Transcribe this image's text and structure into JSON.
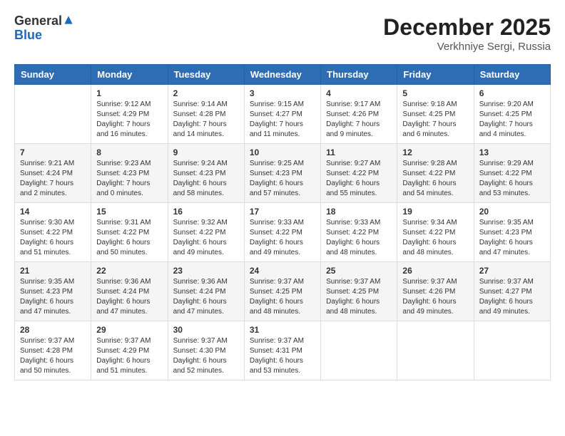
{
  "header": {
    "logo_general": "General",
    "logo_blue": "Blue",
    "month_title": "December 2025",
    "location": "Verkhniye Sergi, Russia"
  },
  "weekdays": [
    "Sunday",
    "Monday",
    "Tuesday",
    "Wednesday",
    "Thursday",
    "Friday",
    "Saturday"
  ],
  "weeks": [
    [
      {
        "day": "",
        "info": ""
      },
      {
        "day": "1",
        "info": "Sunrise: 9:12 AM\nSunset: 4:29 PM\nDaylight: 7 hours\nand 16 minutes."
      },
      {
        "day": "2",
        "info": "Sunrise: 9:14 AM\nSunset: 4:28 PM\nDaylight: 7 hours\nand 14 minutes."
      },
      {
        "day": "3",
        "info": "Sunrise: 9:15 AM\nSunset: 4:27 PM\nDaylight: 7 hours\nand 11 minutes."
      },
      {
        "day": "4",
        "info": "Sunrise: 9:17 AM\nSunset: 4:26 PM\nDaylight: 7 hours\nand 9 minutes."
      },
      {
        "day": "5",
        "info": "Sunrise: 9:18 AM\nSunset: 4:25 PM\nDaylight: 7 hours\nand 6 minutes."
      },
      {
        "day": "6",
        "info": "Sunrise: 9:20 AM\nSunset: 4:25 PM\nDaylight: 7 hours\nand 4 minutes."
      }
    ],
    [
      {
        "day": "7",
        "info": "Sunrise: 9:21 AM\nSunset: 4:24 PM\nDaylight: 7 hours\nand 2 minutes."
      },
      {
        "day": "8",
        "info": "Sunrise: 9:23 AM\nSunset: 4:23 PM\nDaylight: 7 hours\nand 0 minutes."
      },
      {
        "day": "9",
        "info": "Sunrise: 9:24 AM\nSunset: 4:23 PM\nDaylight: 6 hours\nand 58 minutes."
      },
      {
        "day": "10",
        "info": "Sunrise: 9:25 AM\nSunset: 4:23 PM\nDaylight: 6 hours\nand 57 minutes."
      },
      {
        "day": "11",
        "info": "Sunrise: 9:27 AM\nSunset: 4:22 PM\nDaylight: 6 hours\nand 55 minutes."
      },
      {
        "day": "12",
        "info": "Sunrise: 9:28 AM\nSunset: 4:22 PM\nDaylight: 6 hours\nand 54 minutes."
      },
      {
        "day": "13",
        "info": "Sunrise: 9:29 AM\nSunset: 4:22 PM\nDaylight: 6 hours\nand 53 minutes."
      }
    ],
    [
      {
        "day": "14",
        "info": "Sunrise: 9:30 AM\nSunset: 4:22 PM\nDaylight: 6 hours\nand 51 minutes."
      },
      {
        "day": "15",
        "info": "Sunrise: 9:31 AM\nSunset: 4:22 PM\nDaylight: 6 hours\nand 50 minutes."
      },
      {
        "day": "16",
        "info": "Sunrise: 9:32 AM\nSunset: 4:22 PM\nDaylight: 6 hours\nand 49 minutes."
      },
      {
        "day": "17",
        "info": "Sunrise: 9:33 AM\nSunset: 4:22 PM\nDaylight: 6 hours\nand 49 minutes."
      },
      {
        "day": "18",
        "info": "Sunrise: 9:33 AM\nSunset: 4:22 PM\nDaylight: 6 hours\nand 48 minutes."
      },
      {
        "day": "19",
        "info": "Sunrise: 9:34 AM\nSunset: 4:22 PM\nDaylight: 6 hours\nand 48 minutes."
      },
      {
        "day": "20",
        "info": "Sunrise: 9:35 AM\nSunset: 4:23 PM\nDaylight: 6 hours\nand 47 minutes."
      }
    ],
    [
      {
        "day": "21",
        "info": "Sunrise: 9:35 AM\nSunset: 4:23 PM\nDaylight: 6 hours\nand 47 minutes."
      },
      {
        "day": "22",
        "info": "Sunrise: 9:36 AM\nSunset: 4:24 PM\nDaylight: 6 hours\nand 47 minutes."
      },
      {
        "day": "23",
        "info": "Sunrise: 9:36 AM\nSunset: 4:24 PM\nDaylight: 6 hours\nand 47 minutes."
      },
      {
        "day": "24",
        "info": "Sunrise: 9:37 AM\nSunset: 4:25 PM\nDaylight: 6 hours\nand 48 minutes."
      },
      {
        "day": "25",
        "info": "Sunrise: 9:37 AM\nSunset: 4:25 PM\nDaylight: 6 hours\nand 48 minutes."
      },
      {
        "day": "26",
        "info": "Sunrise: 9:37 AM\nSunset: 4:26 PM\nDaylight: 6 hours\nand 49 minutes."
      },
      {
        "day": "27",
        "info": "Sunrise: 9:37 AM\nSunset: 4:27 PM\nDaylight: 6 hours\nand 49 minutes."
      }
    ],
    [
      {
        "day": "28",
        "info": "Sunrise: 9:37 AM\nSunset: 4:28 PM\nDaylight: 6 hours\nand 50 minutes."
      },
      {
        "day": "29",
        "info": "Sunrise: 9:37 AM\nSunset: 4:29 PM\nDaylight: 6 hours\nand 51 minutes."
      },
      {
        "day": "30",
        "info": "Sunrise: 9:37 AM\nSunset: 4:30 PM\nDaylight: 6 hours\nand 52 minutes."
      },
      {
        "day": "31",
        "info": "Sunrise: 9:37 AM\nSunset: 4:31 PM\nDaylight: 6 hours\nand 53 minutes."
      },
      {
        "day": "",
        "info": ""
      },
      {
        "day": "",
        "info": ""
      },
      {
        "day": "",
        "info": ""
      }
    ]
  ]
}
